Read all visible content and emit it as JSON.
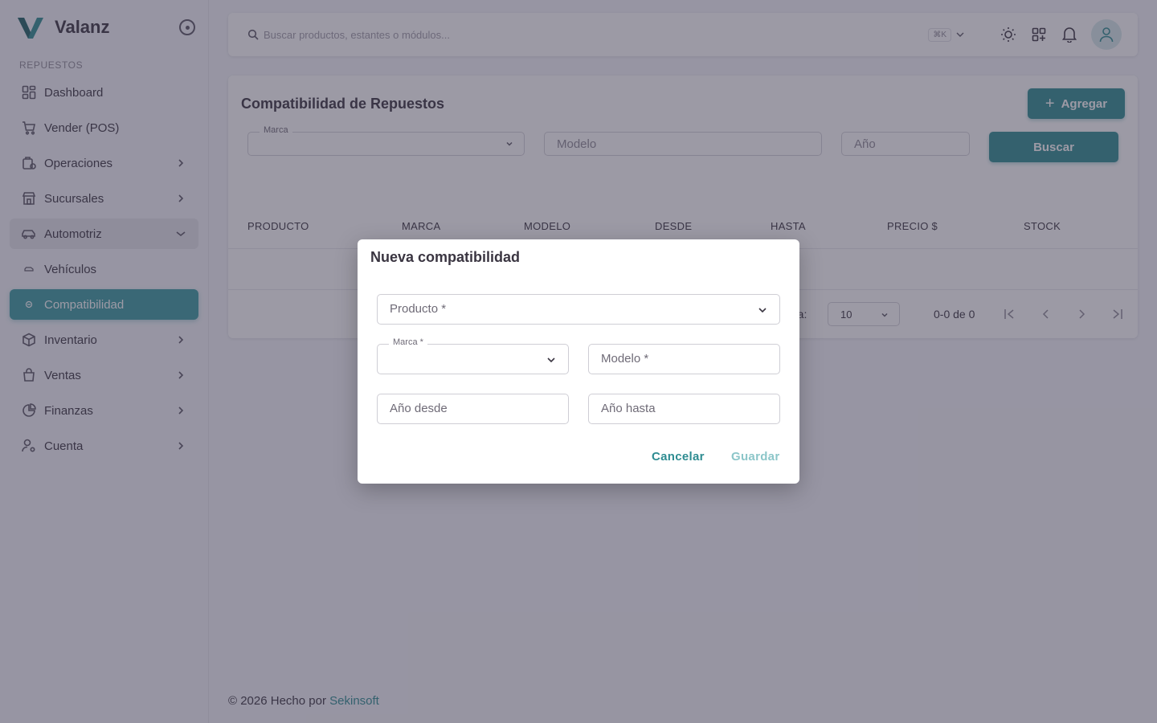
{
  "app": {
    "name": "Valanz"
  },
  "sidebar": {
    "section": "REPUESTOS",
    "items": [
      {
        "label": "Dashboard",
        "icon": "dashboard-icon"
      },
      {
        "label": "Vender (POS)",
        "icon": "cart-icon"
      },
      {
        "label": "Operaciones",
        "icon": "operations-icon"
      },
      {
        "label": "Sucursales",
        "icon": "store-icon"
      },
      {
        "label": "Automotriz",
        "icon": "car-icon"
      },
      {
        "label": "Vehículos",
        "icon": "vehicle-icon"
      },
      {
        "label": "Compatibilidad",
        "icon": "compatibility-icon"
      },
      {
        "label": "Inventario",
        "icon": "box-icon"
      },
      {
        "label": "Ventas",
        "icon": "bag-icon"
      },
      {
        "label": "Finanzas",
        "icon": "pie-chart-icon"
      },
      {
        "label": "Cuenta",
        "icon": "user-settings-icon"
      }
    ]
  },
  "topbar": {
    "search_placeholder": "Buscar productos, estantes o módulos...",
    "shortcut": "⌘K"
  },
  "page": {
    "title": "Compatibilidad de Repuestos",
    "add_button": "Agregar",
    "search_button": "Buscar",
    "filters": {
      "marca_label": "Marca",
      "modelo_placeholder": "Modelo",
      "anio_placeholder": "Año"
    },
    "columns": [
      "PRODUCTO",
      "MARCA",
      "MODELO",
      "DESDE",
      "HASTA",
      "PRECIO $",
      "STOCK"
    ],
    "pager": {
      "label": "gina:",
      "rows_per_page": "10",
      "range": "0-0 de 0"
    }
  },
  "footer": {
    "prefix": "© 2026 Hecho por",
    "brand": "Sekinsoft"
  },
  "dialog": {
    "title": "Nueva compatibilidad",
    "producto_placeholder": "Producto *",
    "marca_label": "Marca *",
    "modelo_placeholder": "Modelo *",
    "anio_desde_placeholder": "Año desde",
    "anio_hasta_placeholder": "Año hasta",
    "cancel": "Cancelar",
    "save": "Guardar"
  },
  "colors": {
    "primary": "#2e8c91",
    "active_nav": "#3b9ba0",
    "text": "#3a3541"
  }
}
